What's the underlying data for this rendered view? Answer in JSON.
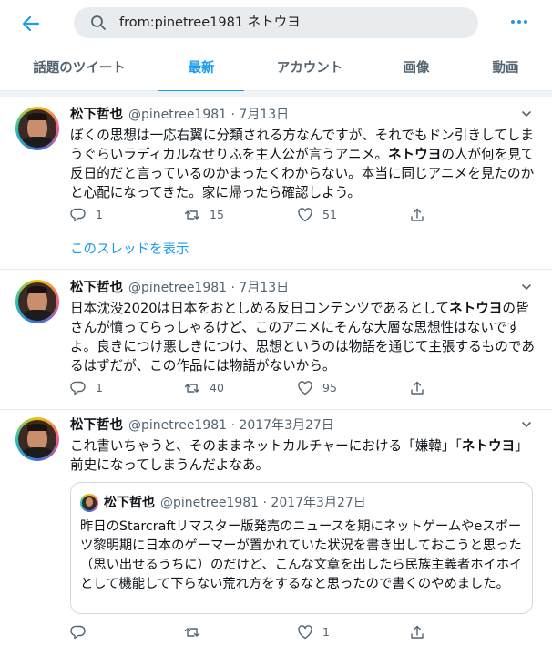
{
  "search": {
    "query": "from:pinetree1981 ネトウヨ"
  },
  "tabs": [
    {
      "label": "話題のツイート"
    },
    {
      "label": "最新"
    },
    {
      "label": "アカウント"
    },
    {
      "label": "画像"
    },
    {
      "label": "動画"
    }
  ],
  "active_tab": "最新",
  "colors": {
    "accent": "#1d9bf0",
    "muted": "#536471",
    "text": "#0f1419",
    "border": "#e6ecf0"
  },
  "tweets": [
    {
      "name": "松下哲也",
      "handle": "@pinetree1981 · 7月13日",
      "text_parts": [
        "ぼくの思想は一応右翼に分類される方なんですが、それでもドン引きしてしまうぐらいラディカルなせりふを主人公が言うアニメ。",
        "ネトウヨ",
        "の人が何を見て反日的だと言っているのかまったくわからない。本当に同じアニメを見たのかと心配になってきた。家に帰ったら確認しよう。"
      ],
      "replies": "1",
      "retweets": "15",
      "likes": "51",
      "thread_link": "このスレッドを表示"
    },
    {
      "name": "松下哲也",
      "handle": "@pinetree1981 · 7月13日",
      "text_parts": [
        "日本沈没2020は日本をおとしめる反日コンテンツであるとして",
        "ネトウヨ",
        "の皆さんが憤ってらっしゃるけど、このアニメにそんな大層な思想性はないですよ。良きにつけ悪しきにつけ、思想というのは物語を通じて主張するものであるはずだが、この作品には物語がないから。"
      ],
      "replies": "1",
      "retweets": "40",
      "likes": "95"
    },
    {
      "name": "松下哲也",
      "handle": "@pinetree1981 · 2017年3月27日",
      "text_parts": [
        "これ書いちゃうと、そのままネットカルチャーにおける「嫌韓」「",
        "ネトウヨ",
        "」前史になってしまうんだよなあ。"
      ],
      "quote": {
        "name": "松下哲也",
        "handle": "@pinetree1981 · 2017年3月27日",
        "text": "昨日のStarcraftリマスター版発売のニュースを期にネットゲームやeスポーツ黎明期に日本のゲーマーが置かれていた状況を書き出しておこうと思った（思い出せるうちに）のだけど、こんな文章を出したら民族主義者ホイホイとして機能して下らない荒れ方をするなと思ったので書くのやめました。"
      },
      "replies": "",
      "retweets": "",
      "likes": "1"
    }
  ],
  "icons": {
    "back": "arrow-left-icon",
    "search": "search-icon",
    "more": "more-dots-icon",
    "reply": "reply-icon",
    "retweet": "retweet-icon",
    "like": "heart-icon",
    "share": "share-icon",
    "caret": "chevron-down-icon"
  }
}
